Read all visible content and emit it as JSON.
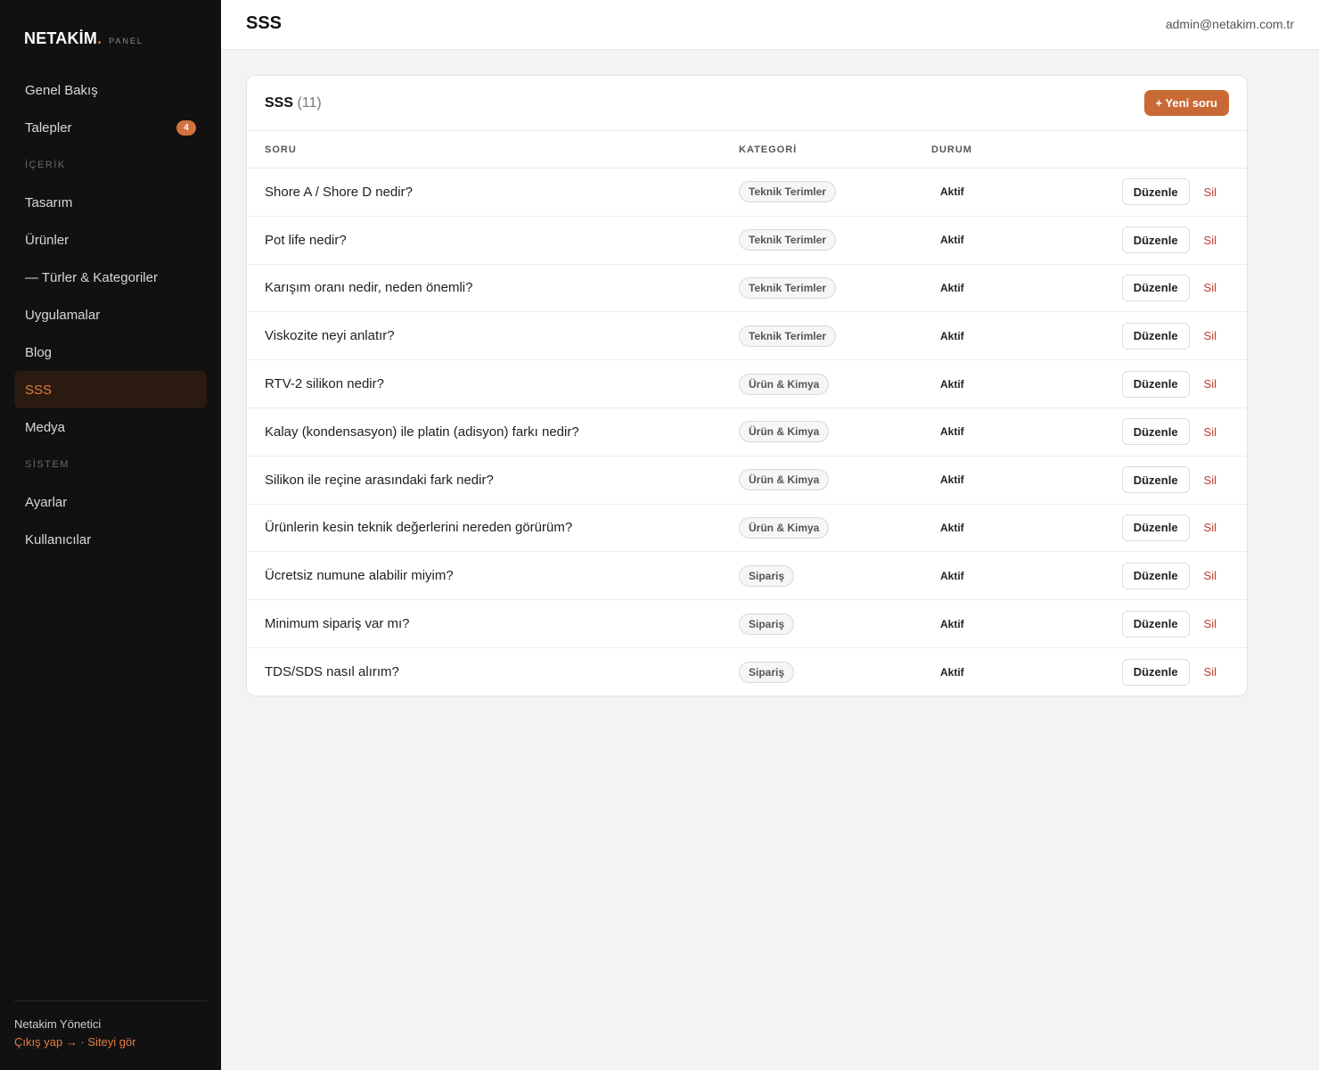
{
  "brand": {
    "name": "NETAKİM",
    "dot": ".",
    "tag": "PANEL"
  },
  "sidebar": {
    "items": [
      {
        "type": "link",
        "label": "Genel Bakış",
        "icon": ""
      },
      {
        "type": "link",
        "label": "Talepler",
        "badge": "4"
      },
      {
        "type": "section",
        "label": "İÇERİK"
      },
      {
        "type": "link",
        "label": "Tasarım"
      },
      {
        "type": "link",
        "label": "Ürünler"
      },
      {
        "type": "link",
        "label": "— Türler & Kategoriler"
      },
      {
        "type": "link",
        "label": "Uygulamalar"
      },
      {
        "type": "link",
        "label": "Blog"
      },
      {
        "type": "link",
        "label": "SSS",
        "active": true
      },
      {
        "type": "link",
        "label": "Medya"
      },
      {
        "type": "section",
        "label": "SİSTEM"
      },
      {
        "type": "link",
        "label": "Ayarlar"
      },
      {
        "type": "link",
        "label": "Kullanıcılar"
      }
    ],
    "footer": {
      "user": "Netakim Yönetici",
      "logout": "Çıkış yap →",
      "separator": "·",
      "view_site": "Siteyi gör"
    }
  },
  "header": {
    "title": "SSS",
    "user_email": "admin@netakim.com.tr"
  },
  "card": {
    "title": "SSS",
    "count": "(11)",
    "new_button": "+ Yeni soru",
    "columns": {
      "question": "SORU",
      "category": "KATEGORİ",
      "status": "DURUM"
    },
    "edit_label": "Düzenle",
    "delete_label": "Sil",
    "rows": [
      {
        "question": "Shore A / Shore D nedir?",
        "category": "Teknik Terimler",
        "status": "Aktif"
      },
      {
        "question": "Pot life nedir?",
        "category": "Teknik Terimler",
        "status": "Aktif"
      },
      {
        "question": "Karışım oranı nedir, neden önemli?",
        "category": "Teknik Terimler",
        "status": "Aktif"
      },
      {
        "question": "Viskozite neyi anlatır?",
        "category": "Teknik Terimler",
        "status": "Aktif"
      },
      {
        "question": "RTV-2 silikon nedir?",
        "category": "Ürün & Kimya",
        "status": "Aktif"
      },
      {
        "question": "Kalay (kondensasyon) ile platin (adisyon) farkı nedir?",
        "category": "Ürün & Kimya",
        "status": "Aktif"
      },
      {
        "question": "Silikon ile reçine arasındaki fark nedir?",
        "category": "Ürün & Kimya",
        "status": "Aktif"
      },
      {
        "question": "Ürünlerin kesin teknik değerlerini nereden görürüm?",
        "category": "Ürün & Kimya",
        "status": "Aktif"
      },
      {
        "question": "Ücretsiz numune alabilir miyim?",
        "category": "Sipariş",
        "status": "Aktif"
      },
      {
        "question": "Minimum sipariş var mı?",
        "category": "Sipariş",
        "status": "Aktif"
      },
      {
        "question": "TDS/SDS nasıl alırım?",
        "category": "Sipariş",
        "status": "Aktif"
      }
    ]
  },
  "colors": {
    "accent": "#c96a36",
    "sidebar_bg": "#111112",
    "danger": "#c0392b"
  }
}
